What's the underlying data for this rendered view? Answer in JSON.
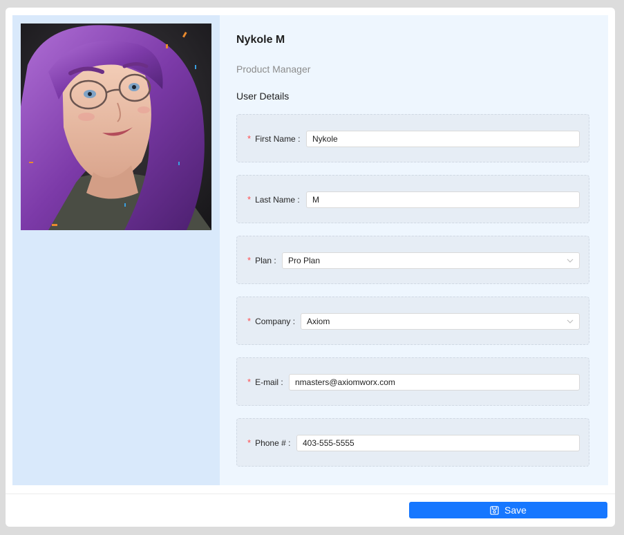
{
  "profile": {
    "name": "Nykole M",
    "role": "Product Manager",
    "avatar_icon": "user-portrait-illustration"
  },
  "form": {
    "section_title": "User Details",
    "fields": [
      {
        "label": "First Name :",
        "value": "Nykole",
        "type": "text",
        "required": true
      },
      {
        "label": "Last Name :",
        "value": "M",
        "type": "text",
        "required": true
      },
      {
        "label": "Plan :",
        "value": "Pro Plan",
        "type": "select",
        "required": true
      },
      {
        "label": "Company :",
        "value": "Axiom",
        "type": "select",
        "required": true
      },
      {
        "label": "E-mail :",
        "value": "nmasters@axiomworx.com",
        "type": "text",
        "required": true
      },
      {
        "label": "Phone # :",
        "value": "403-555-5555",
        "type": "text",
        "required": true
      }
    ],
    "required_marker": "*"
  },
  "footer": {
    "save_label": "Save",
    "save_icon": "save-icon"
  },
  "colors": {
    "accent": "#1677ff",
    "required": "#ff4d4f",
    "left_pane": "#d9e9fb",
    "right_pane": "#eef6fe"
  }
}
